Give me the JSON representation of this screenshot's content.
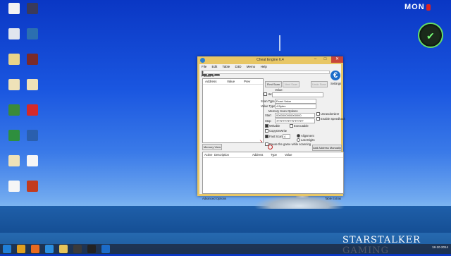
{
  "desktop": {
    "icons": [
      {
        "label": "",
        "color": "#f2f2f2"
      },
      {
        "label": "",
        "color": "#3a3a5a"
      },
      {
        "label": "",
        "color": "#e0e6ee"
      },
      {
        "label": "",
        "color": "#2b6fb0"
      },
      {
        "label": "",
        "color": "#e8d48a"
      },
      {
        "label": "",
        "color": "#7a2a2a"
      },
      {
        "label": "",
        "color": "#efe2b8"
      },
      {
        "label": "",
        "color": "#efe2b8"
      },
      {
        "label": "",
        "color": "#3a8a3a"
      },
      {
        "label": "",
        "color": "#d42a2a"
      },
      {
        "label": "",
        "color": "#2e8f3e"
      },
      {
        "label": "",
        "color": "#2a5fae"
      },
      {
        "label": "",
        "color": "#efe2b8"
      },
      {
        "label": "",
        "color": "#f6f6f6"
      },
      {
        "label": "",
        "color": "#f6f6f6"
      },
      {
        "label": "",
        "color": "#c23b1e"
      }
    ],
    "brand": "MON",
    "brand_badge": "",
    "watermark": "STARSTALKER GAMING"
  },
  "window": {
    "title": "Cheat Engine 6.4",
    "menu": [
      "File",
      "Edit",
      "Table",
      "D3D",
      "Memo",
      "Help"
    ],
    "process": "00002BB8-Planetbase.exe",
    "found": "Found: 0",
    "results_headers": [
      "Address",
      "Value",
      "Prev"
    ],
    "buttons": {
      "first_scan": "First Scan",
      "next_scan": "Next Scan",
      "undo_scan": "Undo Scan",
      "memory_view": "Memory View",
      "add_address": "Add Address Manually"
    },
    "settings_label": "Settings",
    "value_label": "Value:",
    "hex_label": "Hex",
    "scan_type_label": "Scan Type",
    "scan_type_value": "Exact Value",
    "value_type_label": "Value Type",
    "value_type_value": "4 Bytes",
    "memory_scan_options": "Memory Scan Options",
    "start_label": "Start",
    "start_value": "0000000000000000",
    "stop_label": "Stop",
    "stop_value": "7FFFFFFFFFFFFFFF",
    "writable": "Writable",
    "executable": "Executable",
    "copy_on_write": "CopyOnWrite",
    "fast_scan": "Fast Scan",
    "fast_scan_value": "4",
    "alignment": "Alignment",
    "last_digits": "Last Digits",
    "pause_game": "Pause the game while scanning",
    "unrandomizer": "Unrandomizer",
    "enable_speedhack": "Enable Speedhack",
    "addr_headers": [
      "Active",
      "Description",
      "Address",
      "Type",
      "Value"
    ],
    "advanced_options": "Advanced Options",
    "table_extras": "Table Extras"
  },
  "taskbar": {
    "items": [
      {
        "name": "start",
        "color": "#1f7fd8"
      },
      {
        "name": "chrome",
        "color": "#e0a020"
      },
      {
        "name": "firefox",
        "color": "#e86a1e"
      },
      {
        "name": "ie",
        "color": "#2a8ee0"
      },
      {
        "name": "explorer",
        "color": "#e6c45a"
      },
      {
        "name": "app",
        "color": "#3a3a3a"
      },
      {
        "name": "unity",
        "color": "#222"
      },
      {
        "name": "cheat-engine",
        "color": "#1c6cc9"
      }
    ],
    "time": "",
    "date": "18-10-2014"
  }
}
